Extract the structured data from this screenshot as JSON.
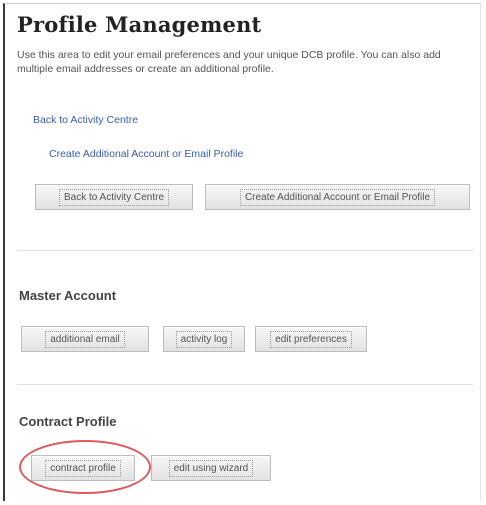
{
  "page": {
    "title": "Profile Management",
    "intro": "Use this area to edit your email preferences and your unique DCB profile. You can also add multiple email addresses or create an additional profile."
  },
  "links": {
    "back_to_activity": "Back to Activity Centre",
    "create_additional": "Create Additional Account or Email Profile"
  },
  "top_buttons": {
    "back": "Back to Activity Centre",
    "create": "Create Additional Account or Email Profile"
  },
  "master_account": {
    "heading": "Master Account",
    "buttons": [
      "additional email",
      "activity log",
      "edit preferences"
    ]
  },
  "contract_profile": {
    "heading": "Contract Profile",
    "buttons": [
      "contract profile",
      "edit using wizard"
    ]
  },
  "annotation": {
    "color": "#e05a5a",
    "target": "contract profile"
  }
}
